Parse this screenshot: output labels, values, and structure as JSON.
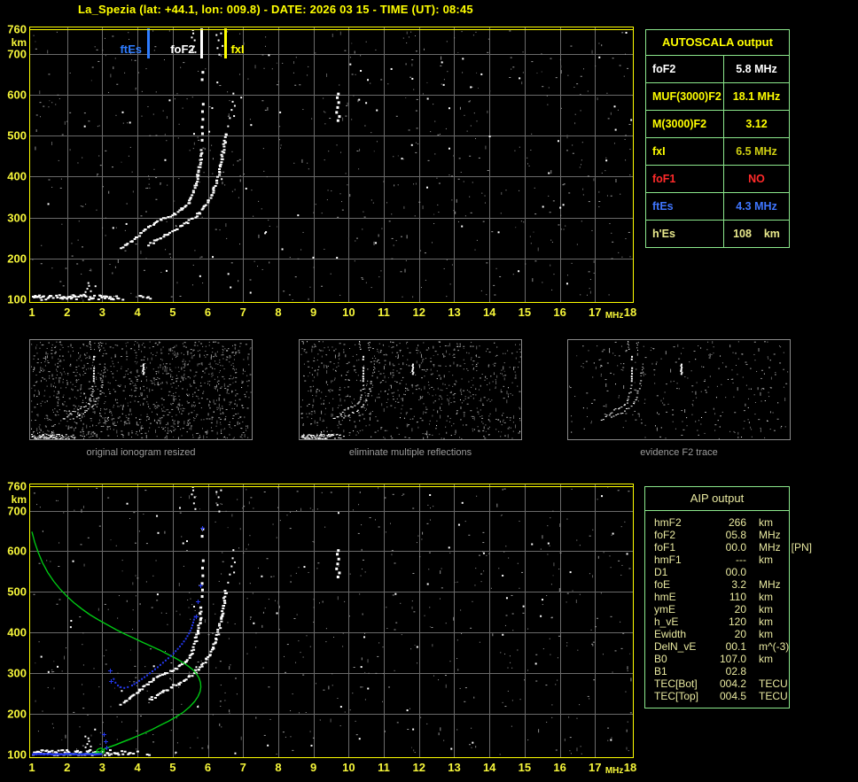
{
  "title": "La_Spezia (lat: +44.1, lon: 009.8) - DATE: 2026 03 15 - TIME (UT): 08:45",
  "colors": {
    "background": "#000000",
    "axis_text": "#f6f63a",
    "plot_border": "#ffff00",
    "grid": "#6a6a6a",
    "table_border": "#8ce88c",
    "trace_white": "#ffffff",
    "noise_gray": "#9b9b9b",
    "profile_green": "#00c814",
    "fit_blue": "#2438f0",
    "caption_gray": "#9c9c9c"
  },
  "autoscala_table": {
    "header": "AUTOSCALA output",
    "rows": [
      {
        "label": "foF2",
        "value": "5.8 MHz",
        "color": "#ffffff",
        "value_color": "#ffffff"
      },
      {
        "label": "MUF(3000)F2",
        "value": "18.1 MHz",
        "color": "#ffff00",
        "value_color": "#ffff00"
      },
      {
        "label": "M(3000)F2",
        "value": "3.12",
        "color": "#ffff00",
        "value_color": "#ffff00"
      },
      {
        "label": "fxI",
        "value": "6.5 MHz",
        "color": "#ffff00",
        "value_color": "#cfcf12"
      },
      {
        "label": "foF1",
        "value": "NO",
        "color": "#ff2a2a",
        "value_color": "#ff2a2a"
      },
      {
        "label": "ftEs",
        "value": "4.3 MHz",
        "color": "#3f76ff",
        "value_color": "#3f76ff"
      },
      {
        "label": "h'Es",
        "value": "108    km",
        "color": "#e9e98c",
        "value_color": "#e9e98c"
      }
    ]
  },
  "aip_table": {
    "header": "AIP output",
    "rows": [
      {
        "label": "hmF2",
        "value": "266",
        "unit": "km",
        "note": ""
      },
      {
        "label": "foF2",
        "value": "05.8",
        "unit": "MHz",
        "note": ""
      },
      {
        "label": "foF1",
        "value": "00.0",
        "unit": "MHz",
        "note": "[PN]"
      },
      {
        "label": "hmF1",
        "value": "---",
        "unit": "km",
        "note": ""
      },
      {
        "label": "D1",
        "value": "00.0",
        "unit": "",
        "note": ""
      },
      {
        "label": "foE",
        "value": "3.2",
        "unit": "MHz",
        "note": ""
      },
      {
        "label": "hmE",
        "value": "110",
        "unit": "km",
        "note": ""
      },
      {
        "label": "ymE",
        "value": "20",
        "unit": "km",
        "note": ""
      },
      {
        "label": "h_vE",
        "value": "120",
        "unit": "km",
        "note": ""
      },
      {
        "label": "Ewidth",
        "value": "20",
        "unit": "km",
        "note": ""
      },
      {
        "label": "DelN_vE",
        "value": "00.1",
        "unit": "m^(-3)",
        "note": ""
      },
      {
        "label": "B0",
        "value": "107.0",
        "unit": "km",
        "note": ""
      },
      {
        "label": "B1",
        "value": "02.8",
        "unit": "",
        "note": ""
      },
      {
        "label": "TEC[Bot]",
        "value": "004.2",
        "unit": "TECU",
        "note": ""
      },
      {
        "label": "TEC[Top]",
        "value": "004.5",
        "unit": "TECU",
        "note": ""
      }
    ]
  },
  "chart_data": {
    "type": "scatter",
    "title": "ionogram with AUTOSCALA interpretation",
    "x_label": "MHz",
    "y_label": "km",
    "x_range": [
      1,
      18
    ],
    "y_range": [
      100,
      760
    ],
    "x_ticks": [
      1,
      2,
      3,
      4,
      5,
      6,
      7,
      8,
      9,
      10,
      11,
      12,
      13,
      14,
      15,
      16,
      17,
      18
    ],
    "y_ticks": [
      760,
      700,
      600,
      500,
      400,
      300,
      200,
      100
    ],
    "grid": true,
    "markers": [
      {
        "label": "ftEs",
        "freq": 4.3,
        "color": "#2e7cff",
        "label_side": "left"
      },
      {
        "label": "foF2",
        "freq": 5.8,
        "color": "#ffffff",
        "label_side": "left"
      },
      {
        "label": "fxI",
        "freq": 6.5,
        "color": "#ffff00",
        "label_side": "right"
      }
    ],
    "traces": {
      "es_layer": {
        "from": 1.0,
        "to": 4.35,
        "height_km": 107
      },
      "es_patch": [
        [
          2.5,
          120
        ],
        [
          2.55,
          128
        ],
        [
          2.6,
          135
        ],
        [
          2.58,
          142
        ],
        [
          2.65,
          122
        ]
      ],
      "o_trace": [
        [
          3.5,
          227
        ],
        [
          3.62,
          233
        ],
        [
          3.75,
          241
        ],
        [
          3.88,
          250
        ],
        [
          4.0,
          259
        ],
        [
          4.12,
          268
        ],
        [
          4.25,
          277
        ],
        [
          4.4,
          286
        ],
        [
          4.55,
          293
        ],
        [
          4.72,
          300
        ],
        [
          4.9,
          306
        ],
        [
          5.05,
          312
        ],
        [
          5.2,
          320
        ],
        [
          5.32,
          329
        ],
        [
          5.42,
          339
        ],
        [
          5.5,
          352
        ],
        [
          5.57,
          367
        ],
        [
          5.62,
          383
        ],
        [
          5.67,
          400
        ],
        [
          5.71,
          418
        ],
        [
          5.74,
          436
        ],
        [
          5.77,
          455
        ],
        [
          5.79,
          472
        ]
      ],
      "o_asymptote": [
        [
          5.8,
          492
        ],
        [
          5.81,
          508
        ],
        [
          5.8,
          524
        ],
        [
          5.82,
          543
        ],
        [
          5.81,
          562
        ],
        [
          5.83,
          580
        ],
        [
          5.8,
          640
        ],
        [
          5.82,
          658
        ]
      ],
      "x_trace": [
        [
          4.3,
          236
        ],
        [
          4.45,
          244
        ],
        [
          4.6,
          252
        ],
        [
          4.78,
          260
        ],
        [
          4.95,
          268
        ],
        [
          5.12,
          276
        ],
        [
          5.3,
          285
        ],
        [
          5.45,
          294
        ],
        [
          5.6,
          304
        ],
        [
          5.75,
          316
        ],
        [
          5.88,
          330
        ],
        [
          6.0,
          346
        ],
        [
          6.1,
          362
        ],
        [
          6.18,
          380
        ],
        [
          6.25,
          400
        ],
        [
          6.3,
          420
        ],
        [
          6.35,
          442
        ],
        [
          6.4,
          465
        ],
        [
          6.44,
          488
        ],
        [
          6.48,
          510
        ]
      ],
      "x_asymptote": [
        [
          6.55,
          525
        ],
        [
          6.6,
          545
        ],
        [
          6.65,
          565
        ],
        [
          6.68,
          585
        ],
        [
          6.7,
          605
        ],
        [
          6.72,
          550
        ],
        [
          6.74,
          575
        ]
      ],
      "top_spread": [
        [
          5.52,
          742
        ],
        [
          5.56,
          752
        ],
        [
          5.6,
          735
        ],
        [
          5.58,
          720
        ],
        [
          5.62,
          706
        ],
        [
          5.55,
          760
        ],
        [
          6.22,
          748
        ],
        [
          6.28,
          735
        ],
        [
          6.25,
          716
        ],
        [
          6.3,
          700
        ],
        [
          6.35,
          752
        ]
      ],
      "interference": [
        [
          9.62,
          560
        ],
        [
          9.65,
          572
        ],
        [
          9.68,
          584
        ],
        [
          9.64,
          596
        ],
        [
          9.67,
          605
        ],
        [
          9.7,
          550
        ],
        [
          9.66,
          540
        ]
      ]
    },
    "profile_green": [
      [
        1.0,
        648
      ],
      [
        1.08,
        622
      ],
      [
        1.18,
        597
      ],
      [
        1.3,
        572
      ],
      [
        1.45,
        548
      ],
      [
        1.62,
        526
      ],
      [
        1.8,
        507
      ],
      [
        2.0,
        489
      ],
      [
        2.2,
        473
      ],
      [
        2.42,
        458
      ],
      [
        2.65,
        444
      ],
      [
        2.9,
        431
      ],
      [
        3.15,
        419
      ],
      [
        3.4,
        407
      ],
      [
        3.65,
        396
      ],
      [
        3.9,
        386
      ],
      [
        4.15,
        376
      ],
      [
        4.4,
        366
      ],
      [
        4.65,
        356
      ],
      [
        4.9,
        345
      ],
      [
        5.1,
        336
      ],
      [
        5.3,
        326
      ],
      [
        5.45,
        317
      ],
      [
        5.58,
        308
      ],
      [
        5.68,
        298
      ],
      [
        5.75,
        288
      ],
      [
        5.79,
        277
      ],
      [
        5.8,
        266
      ],
      [
        5.78,
        255
      ],
      [
        5.72,
        243
      ],
      [
        5.62,
        230
      ],
      [
        5.48,
        217
      ],
      [
        5.3,
        204
      ],
      [
        5.1,
        193
      ],
      [
        4.88,
        182
      ],
      [
        4.65,
        172
      ],
      [
        4.42,
        162
      ],
      [
        4.2,
        153
      ],
      [
        3.98,
        145
      ],
      [
        3.76,
        137
      ],
      [
        3.55,
        130
      ],
      [
        3.38,
        124
      ],
      [
        3.22,
        119
      ],
      [
        3.1,
        115
      ],
      [
        3.03,
        112
      ],
      [
        3.06,
        108
      ],
      [
        3.02,
        104
      ],
      [
        2.94,
        103
      ],
      [
        2.86,
        105
      ],
      [
        2.84,
        110
      ],
      [
        2.89,
        114
      ],
      [
        2.97,
        116
      ],
      [
        3.02,
        113
      ],
      [
        2.95,
        107
      ],
      [
        2.8,
        104
      ],
      [
        2.6,
        102
      ],
      [
        2.38,
        101
      ],
      [
        2.15,
        101
      ],
      [
        1.95,
        100
      ]
    ],
    "blue_baseline": {
      "from": 1.0,
      "to": 2.95,
      "height_km": 103
    },
    "blue_fit": [
      [
        3.3,
        288
      ],
      [
        3.35,
        279
      ],
      [
        3.42,
        272
      ],
      [
        3.5,
        268
      ],
      [
        3.6,
        266
      ],
      [
        3.7,
        268
      ],
      [
        3.82,
        272
      ],
      [
        3.95,
        279
      ],
      [
        4.1,
        288
      ],
      [
        4.25,
        297
      ],
      [
        4.4,
        307
      ],
      [
        4.55,
        317
      ],
      [
        4.7,
        328
      ],
      [
        4.85,
        339
      ],
      [
        5.0,
        351
      ],
      [
        5.12,
        362
      ],
      [
        5.24,
        374
      ],
      [
        5.35,
        387
      ],
      [
        5.44,
        400
      ],
      [
        5.51,
        413
      ],
      [
        5.56,
        427
      ],
      [
        5.6,
        441
      ],
      [
        5.62,
        452
      ]
    ],
    "blue_marks": [
      [
        3.22,
        306
      ],
      [
        3.25,
        281
      ],
      [
        5.67,
        440
      ],
      [
        5.72,
        477
      ],
      [
        5.79,
        517
      ],
      [
        5.83,
        657
      ],
      [
        3.05,
        150
      ],
      [
        3.08,
        133
      ],
      [
        3.12,
        117
      ]
    ],
    "thumbnails": [
      {
        "caption": "original ionogram resized"
      },
      {
        "caption": "eliminate multiple reflections"
      },
      {
        "caption": "evidence F2 trace"
      }
    ],
    "panels": {
      "main": {
        "seed": 11,
        "streaks": 130,
        "dots": 520,
        "white": 70,
        "markers": true,
        "profile": false
      },
      "profile": {
        "seed": 29,
        "streaks": 120,
        "dots": 480,
        "white": 60,
        "markers": false,
        "profile": true
      },
      "thumb1": {
        "seed": 41,
        "streaks": 260,
        "dots": 900,
        "white": 90,
        "es": 1
      },
      "thumb2": {
        "seed": 57,
        "streaks": 180,
        "dots": 550,
        "white": 70,
        "es": 1
      },
      "thumb3": {
        "seed": 73,
        "streaks": 60,
        "dots": 200,
        "white": 45,
        "es": 0
      }
    }
  }
}
